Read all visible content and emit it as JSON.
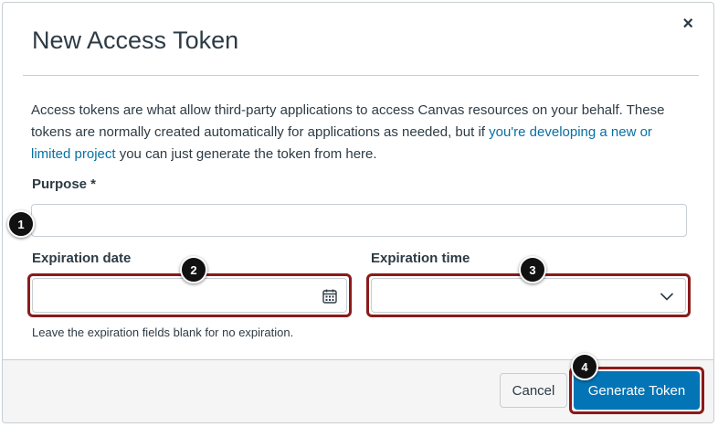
{
  "dialog": {
    "title": "New Access Token",
    "close_symbol": "×",
    "description_before": "Access tokens are what allow third-party applications to access Canvas resources on your behalf. These tokens are normally created automatically for applications as needed, but if ",
    "description_link": "you're developing a new or limited project",
    "description_after": " you can just generate the token from here."
  },
  "purpose": {
    "label": "Purpose *",
    "value": "",
    "badge": "1"
  },
  "expiration_date": {
    "label": "Expiration date",
    "value": "",
    "badge": "2",
    "icon": "calendar-icon"
  },
  "expiration_time": {
    "label": "Expiration time",
    "value": "",
    "badge": "3",
    "icon": "chevron-down-icon"
  },
  "hint": "Leave the expiration fields blank for no expiration.",
  "footer": {
    "cancel_label": "Cancel",
    "generate_label": "Generate Token",
    "generate_badge": "4"
  },
  "colors": {
    "primary": "#0374b5",
    "highlight": "#8b1a1a",
    "link": "#0770a3"
  }
}
